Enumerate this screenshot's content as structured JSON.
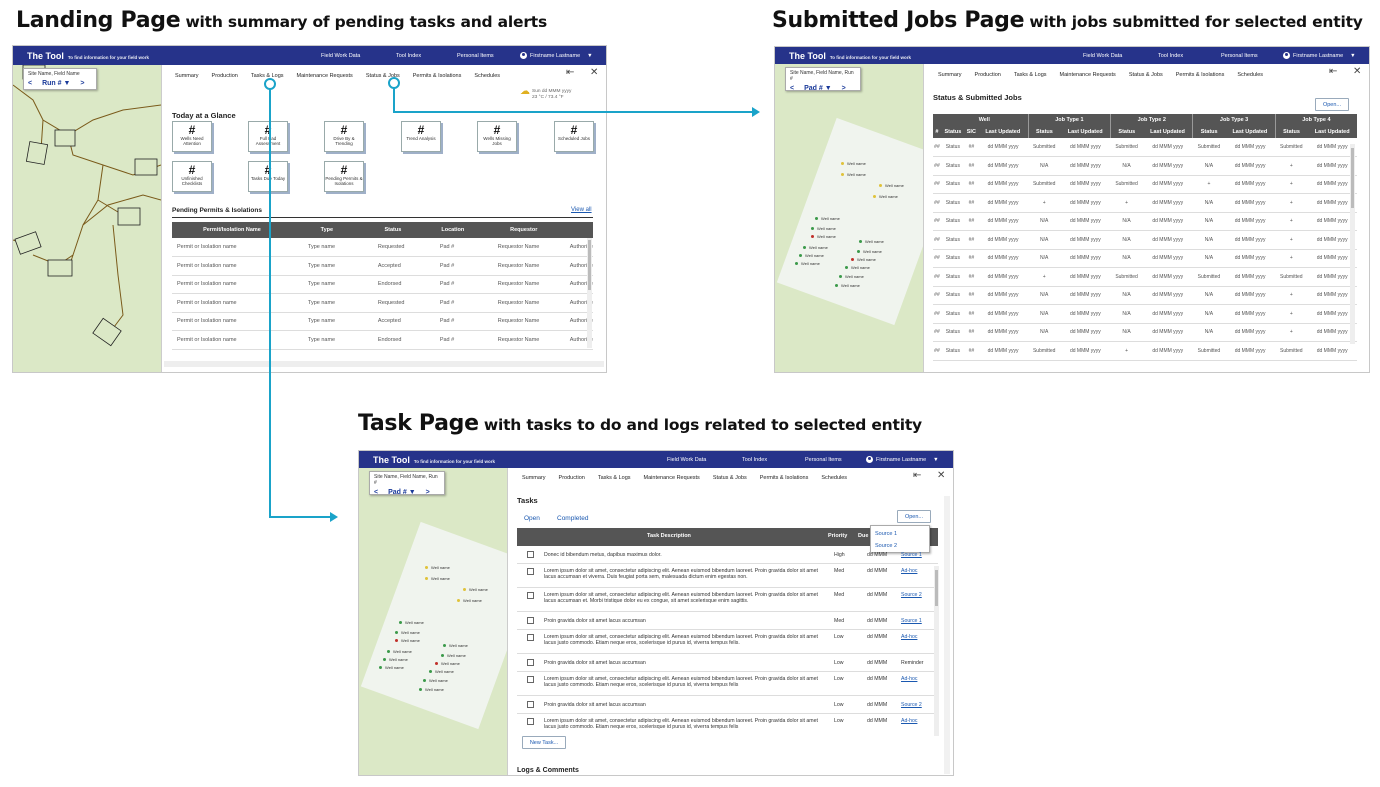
{
  "headings": {
    "landing": {
      "title": "Landing Page",
      "subtitle": "with summary of pending tasks and alerts"
    },
    "jobs": {
      "title": "Submitted Jobs Page",
      "subtitle": "with jobs submitted for selected entity"
    },
    "tasks": {
      "title": "Task Page",
      "subtitle": "with tasks to do and logs related to selected entity"
    }
  },
  "colors": {
    "topbar": "#26338a",
    "accent": "#1aa3c9",
    "link": "#1a58b0",
    "map": "#dbe8c6"
  },
  "topbar": {
    "brand": "The Tool",
    "tagline": "To find information for your field work",
    "links": [
      "Field Work Data",
      "Tool Index",
      "Personal Items"
    ],
    "user": "Firstname Lastname",
    "user_icon": "user-avatar-icon",
    "caret_icon": "caret-down-icon"
  },
  "nav_tabs": [
    "Summary",
    "Production",
    "Tasks & Logs",
    "Maintenance Requests",
    "Status & Jobs",
    "Permits & Isolations",
    "Schedules"
  ],
  "landing": {
    "site_label": "Site Name, Field Name",
    "selector": "Run # ▼",
    "weather": {
      "line1": "Sun dd MMM yyyy",
      "line2": "23 °C / 73.4 °F",
      "icon": "cloud-sun-icon"
    },
    "glance_title": "Today at a Glance",
    "cards": [
      {
        "value": "#",
        "label": "Wells Need Attention"
      },
      {
        "value": "#",
        "label": "Full Pad Assessment"
      },
      {
        "value": "#",
        "label": "Drive By & Trending"
      },
      {
        "value": "#",
        "label": "Trend Analysis"
      },
      {
        "value": "#",
        "label": "Wells Missing Jobs"
      },
      {
        "value": "#",
        "label": "Scheduled Jobs"
      },
      {
        "value": "#",
        "label": "Unfinished Checklists"
      },
      {
        "value": "#",
        "label": "Tasks Due Today"
      },
      {
        "value": "#",
        "label": "Pending Permits & Isolations"
      }
    ],
    "permits_title": "Pending Permits & Isolations",
    "view_all": "View all",
    "permits_columns": [
      "Permit/Isolation Name",
      "Type",
      "Status",
      "Location",
      "Requestor",
      ""
    ],
    "permits_rows": [
      [
        "Permit or Isolation name",
        "Type name",
        "Requested",
        "Pad #",
        "Requestor Name",
        "Authorize"
      ],
      [
        "Permit or Isolation name",
        "Type name",
        "Accepted",
        "Pad #",
        "Requestor Name",
        "Authorize"
      ],
      [
        "Permit or Isolation name",
        "Type name",
        "Endorsed",
        "Pad #",
        "Requestor Name",
        "Authorize"
      ],
      [
        "Permit or Isolation name",
        "Type name",
        "Requested",
        "Pad #",
        "Requestor Name",
        "Authorize"
      ],
      [
        "Permit or Isolation name",
        "Type name",
        "Accepted",
        "Pad #",
        "Requestor Name",
        "Authorize"
      ],
      [
        "Permit or Isolation name",
        "Type name",
        "Endorsed",
        "Pad #",
        "Requestor Name",
        "Authorize"
      ]
    ],
    "permits_active": [
      false,
      false,
      true,
      false,
      false,
      true
    ]
  },
  "jobs": {
    "site_label": "Site Name, Field Name, Run #",
    "selector": "Pad # ▼",
    "title": "Status & Submitted Jobs",
    "open_button": "Open...",
    "group_headers": [
      "Well",
      "Job Type 1",
      "Job Type 2",
      "Job Type 3",
      "Job Type 4"
    ],
    "columns": [
      "#",
      "Status",
      "SIC",
      "Last Updated",
      "Status",
      "Last Updated",
      "Status",
      "Last Updated",
      "Status",
      "Last Updated",
      "Status",
      "Last Updated"
    ],
    "rows": [
      [
        "##",
        "Status",
        "##",
        "dd MMM yyyy",
        "Submitted",
        "dd MMM yyyy",
        "Submitted",
        "dd MMM yyyy",
        "Submitted",
        "dd MMM yyyy",
        "Submitted",
        "dd MMM yyyy"
      ],
      [
        "##",
        "Status",
        "##",
        "dd MMM yyyy",
        "N/A",
        "dd MMM yyyy",
        "N/A",
        "dd MMM yyyy",
        "N/A",
        "dd MMM yyyy",
        "+",
        "dd MMM yyyy"
      ],
      [
        "##",
        "Status",
        "##",
        "dd MMM yyyy",
        "Submitted",
        "dd MMM yyyy",
        "Submitted",
        "dd MMM yyyy",
        "+",
        "dd MMM yyyy",
        "+",
        "dd MMM yyyy"
      ],
      [
        "##",
        "Status",
        "##",
        "dd MMM yyyy",
        "+",
        "dd MMM yyyy",
        "+",
        "dd MMM yyyy",
        "N/A",
        "dd MMM yyyy",
        "+",
        "dd MMM yyyy"
      ],
      [
        "##",
        "Status",
        "##",
        "dd MMM yyyy",
        "N/A",
        "dd MMM yyyy",
        "N/A",
        "dd MMM yyyy",
        "N/A",
        "dd MMM yyyy",
        "+",
        "dd MMM yyyy"
      ],
      [
        "##",
        "Status",
        "##",
        "dd MMM yyyy",
        "N/A",
        "dd MMM yyyy",
        "N/A",
        "dd MMM yyyy",
        "N/A",
        "dd MMM yyyy",
        "+",
        "dd MMM yyyy"
      ],
      [
        "##",
        "Status",
        "##",
        "dd MMM yyyy",
        "N/A",
        "dd MMM yyyy",
        "N/A",
        "dd MMM yyyy",
        "N/A",
        "dd MMM yyyy",
        "+",
        "dd MMM yyyy"
      ],
      [
        "##",
        "Status",
        "##",
        "dd MMM yyyy",
        "+",
        "dd MMM yyyy",
        "Submitted",
        "dd MMM yyyy",
        "Submitted",
        "dd MMM yyyy",
        "Submitted",
        "dd MMM yyyy"
      ],
      [
        "##",
        "Status",
        "##",
        "dd MMM yyyy",
        "N/A",
        "dd MMM yyyy",
        "N/A",
        "dd MMM yyyy",
        "N/A",
        "dd MMM yyyy",
        "+",
        "dd MMM yyyy"
      ],
      [
        "##",
        "Status",
        "##",
        "dd MMM yyyy",
        "N/A",
        "dd MMM yyyy",
        "N/A",
        "dd MMM yyyy",
        "N/A",
        "dd MMM yyyy",
        "+",
        "dd MMM yyyy"
      ],
      [
        "##",
        "Status",
        "##",
        "dd MMM yyyy",
        "N/A",
        "dd MMM yyyy",
        "N/A",
        "dd MMM yyyy",
        "N/A",
        "dd MMM yyyy",
        "+",
        "dd MMM yyyy"
      ],
      [
        "##",
        "Status",
        "##",
        "dd MMM yyyy",
        "Submitted",
        "dd MMM yyyy",
        "+",
        "dd MMM yyyy",
        "Submitted",
        "dd MMM yyyy",
        "Submitted",
        "dd MMM yyyy"
      ]
    ]
  },
  "wells": {
    "label": "Well name",
    "count": 14
  },
  "tasks": {
    "site_label": "Site Name, Field Name, Run #",
    "selector": "Pad # ▼",
    "title": "Tasks",
    "filters": [
      "Open",
      "Completed"
    ],
    "open_button": "Open...",
    "source_menu": [
      "Source 1",
      "Source 2"
    ],
    "columns": [
      "Task Description",
      "Priority",
      "Due",
      "Source"
    ],
    "rows": [
      {
        "desc": "Donec id bibendum metus, dapibus maximus dolor.",
        "priority": "High",
        "due": "dd MMM",
        "source": "Source 1"
      },
      {
        "desc": "Lorem ipsum dolor sit amet, consectetur adipiscing elit. Aenean euismod bibendum laoreet. Proin gravida dolor sit amet lacus accumsan et viverra. Duis feugiat porta sem, malesuada dictum enim egestas non.",
        "priority": "Med",
        "due": "dd MMM",
        "source": "Ad-hoc"
      },
      {
        "desc": "Lorem ipsum dolor sit amet, consectetur adipiscing elit. Aenean euismod bibendum laoreet. Proin gravida dolor sit amet lacus accumsan et. Morbi tristique dolor eu ex congue, sit amet scelerisque enim sagittis.",
        "priority": "Med",
        "due": "dd MMM",
        "source": "Source 2"
      },
      {
        "desc": "Proin gravida dolor sit amet lacus accumsan",
        "priority": "Med",
        "due": "dd MMM",
        "source": "Source 1"
      },
      {
        "desc": "Lorem ipsum dolor sit amet, consectetur adipiscing elit. Aenean euismod bibendum laoreet. Proin gravida dolor sit amet lacus justo commodo. Etiam neque eros, scelerisque id purus id, viverra tempus felis.",
        "priority": "Low",
        "due": "dd MMM",
        "source": "Ad-hoc"
      },
      {
        "desc": "Proin gravida dolor sit amet lacus accumsan",
        "priority": "Low",
        "due": "dd MMM",
        "source": "Reminder"
      },
      {
        "desc": "Lorem ipsum dolor sit amet, consectetur adipiscing elit. Aenean euismod bibendum laoreet. Proin gravida dolor sit amet lacus justo commodo. Etiam neque eros, scelerisque id purus id, viverra tempus felis",
        "priority": "Low",
        "due": "dd MMM",
        "source": "Ad-hoc"
      },
      {
        "desc": "Proin gravida dolor sit amet lacus accumsan",
        "priority": "Low",
        "due": "dd MMM",
        "source": "Source 2"
      },
      {
        "desc": "Lorem ipsum dolor sit amet, consectetur adipiscing elit. Aenean euismod bibendum laoreet. Proin gravida dolor sit amet lacus justo commodo. Etiam neque eros, scelerisque id purus id, viverra tempus felis",
        "priority": "Low",
        "due": "dd MMM",
        "source": "Ad-hoc"
      }
    ],
    "new_task": "New Task...",
    "logs_title": "Logs & Comments"
  }
}
